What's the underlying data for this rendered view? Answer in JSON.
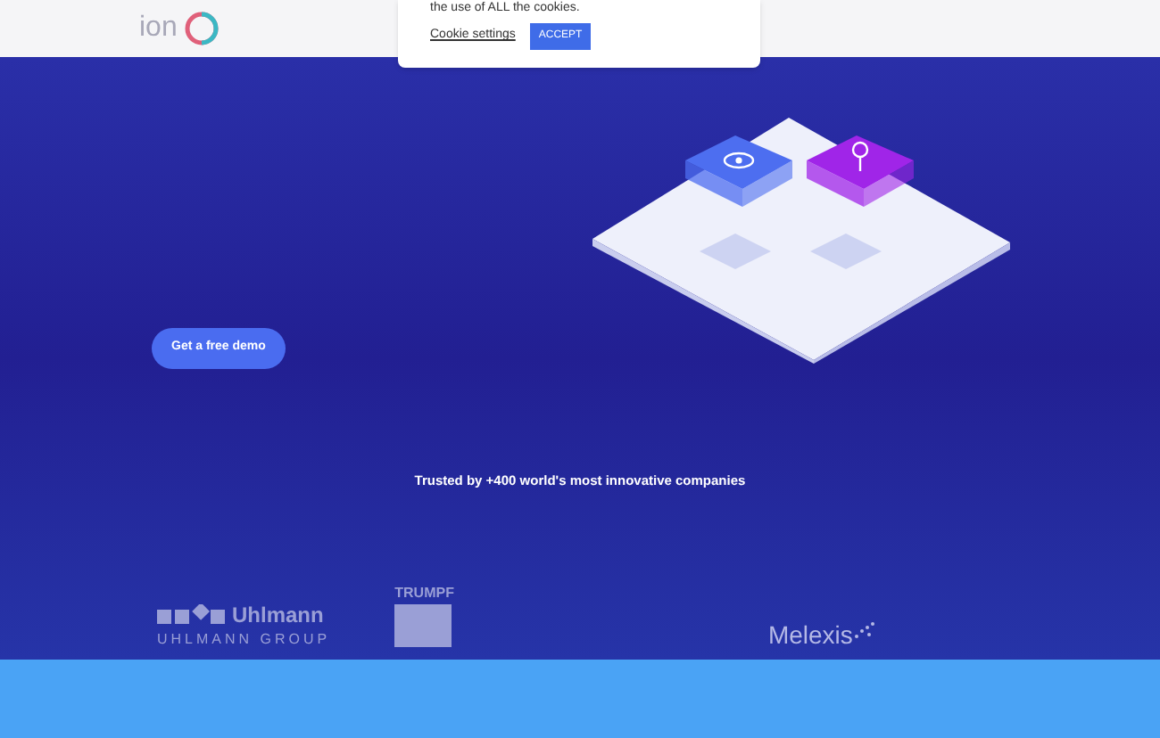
{
  "header": {
    "logo_text": "ion"
  },
  "cookie_banner": {
    "message": "the use of ALL the cookies.",
    "settings_link": "Cookie settings",
    "accept_button": "ACCEPT"
  },
  "hero": {
    "cta_button": "Get a free demo",
    "trusted_text": "Trusted by +400 world's most innovative companies"
  },
  "client_logos": [
    {
      "kind": "uhlmann",
      "name": "Uhlmann",
      "subtitle": "UHLMANN GROUP"
    },
    {
      "kind": "trumpf",
      "name": "TRUMPF"
    },
    {
      "kind": "melexis",
      "name": "Melexis"
    }
  ]
}
